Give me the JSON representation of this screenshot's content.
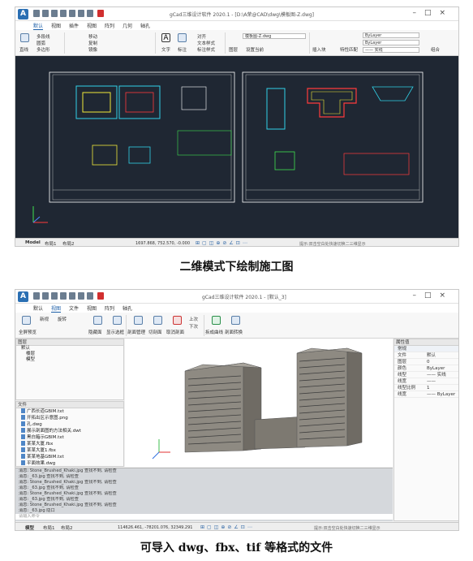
{
  "screenshot1": {
    "app_logo": "A",
    "window_title": "gCad三维设计软件 2020.1 - [D:\\A荣@CAD\\dwg\\模板图-Z.dwg]",
    "menu_tabs": [
      "默认",
      "视图",
      "插件",
      "视图",
      "阵列",
      "几何",
      "轴孔"
    ],
    "ribbon": {
      "draw": [
        "直线",
        "多段线",
        "圆弧",
        "多边形"
      ],
      "modify": [
        "移动",
        "复制",
        "镜像"
      ],
      "annotation": [
        "文字",
        "标注"
      ],
      "text_panel": [
        "对齐",
        "文本样式",
        "标注样式"
      ],
      "layer_select": "模板图-Z.dwg",
      "layer_label": "图层",
      "setting_label": "设置当前",
      "insert_label": "插入块",
      "property_match": "特性匹配",
      "bylayer_color": "ByLayer",
      "bylayer_line": "ByLayer",
      "linetype": "—— 实线",
      "group_label": "组合"
    },
    "layout_tabs": [
      "Model",
      "布局1",
      "布局2"
    ],
    "coords": "1697.868, 752.570, -0.000",
    "hint": "提示:双击空白处快速切换二三维显示",
    "colors": {
      "canvas": "#1f2733",
      "frame": "#ffffff",
      "cyan": "#31d2e8",
      "yellow": "#f1e93a",
      "green": "#3fe24f",
      "red": "#ff3b3b"
    }
  },
  "caption1": "二维模式下绘制施工图",
  "screenshot2": {
    "app_logo": "A",
    "window_title": "gCad三维设计软件 2020.1 - [默认_3]",
    "menu_tabs": [
      "默认",
      "视图",
      "文件",
      "视图",
      "阵列",
      "轴孔"
    ],
    "ribbon": [
      "全屏预览",
      "新视",
      "旋转",
      "隐藏面",
      "显示选框",
      "剖面管理",
      "切剖面",
      "取消剖面",
      "上次",
      "下次",
      "拆成曲线",
      "剖面转换"
    ],
    "layers_panel": {
      "title": "图层",
      "items": [
        "默认",
        "楼层",
        "模型"
      ]
    },
    "files_panel": {
      "title": "文件",
      "items": [
        "广西长道GBIM.txt",
        "开拓出区示意图.png",
        "孔.dwg",
        "展示剖面图的方法相关.dwt",
        "黑白箱示GBIM.txt",
        "某某大厦.fbx",
        "某某大厦1.fbx",
        "某某地基GBIM.txt",
        "平面效果.dwg"
      ]
    },
    "properties_panel": {
      "title": "属性值",
      "section": "常规",
      "rows": [
        {
          "k": "文件",
          "v": "默认"
        },
        {
          "k": "图层",
          "v": "0"
        },
        {
          "k": "颜色",
          "v": "ByLayer"
        },
        {
          "k": "线型",
          "v": "—— 实线"
        },
        {
          "k": "线宽",
          "v": "——"
        },
        {
          "k": "线型比例",
          "v": "1"
        },
        {
          "k": "线宽",
          "v": "—— ByLayer"
        }
      ]
    },
    "command_lines": [
      "消息: Stone_Brushed_Khaki.jpg 查找不到, 请检查",
      "消息: _63.jpg 查找不到, 请检查",
      "消息: Stone_Brushed_Khaki.jpg 查找不到, 请检查",
      "消息: _63.jpg 查找不到, 请检查",
      "消息: Stone_Brushed_Khaki.jpg 查找不到, 请检查",
      "消息: _63.jpg 查找不到, 请检查",
      "消息: Stone_Brushed_Khaki.jpg 查找不到, 请检查",
      "消息: _63.jpg 隐口"
    ],
    "command_prompt": "请输入命令",
    "layout_tabs": [
      "模型",
      "布局1",
      "布局2"
    ],
    "coords": "114626.461, -78201.076, 32349.291",
    "hint": "提示:双击空白处快速切换二三维显示"
  },
  "caption2": "可导入 dwg、fbx、tif 等格式的文件"
}
